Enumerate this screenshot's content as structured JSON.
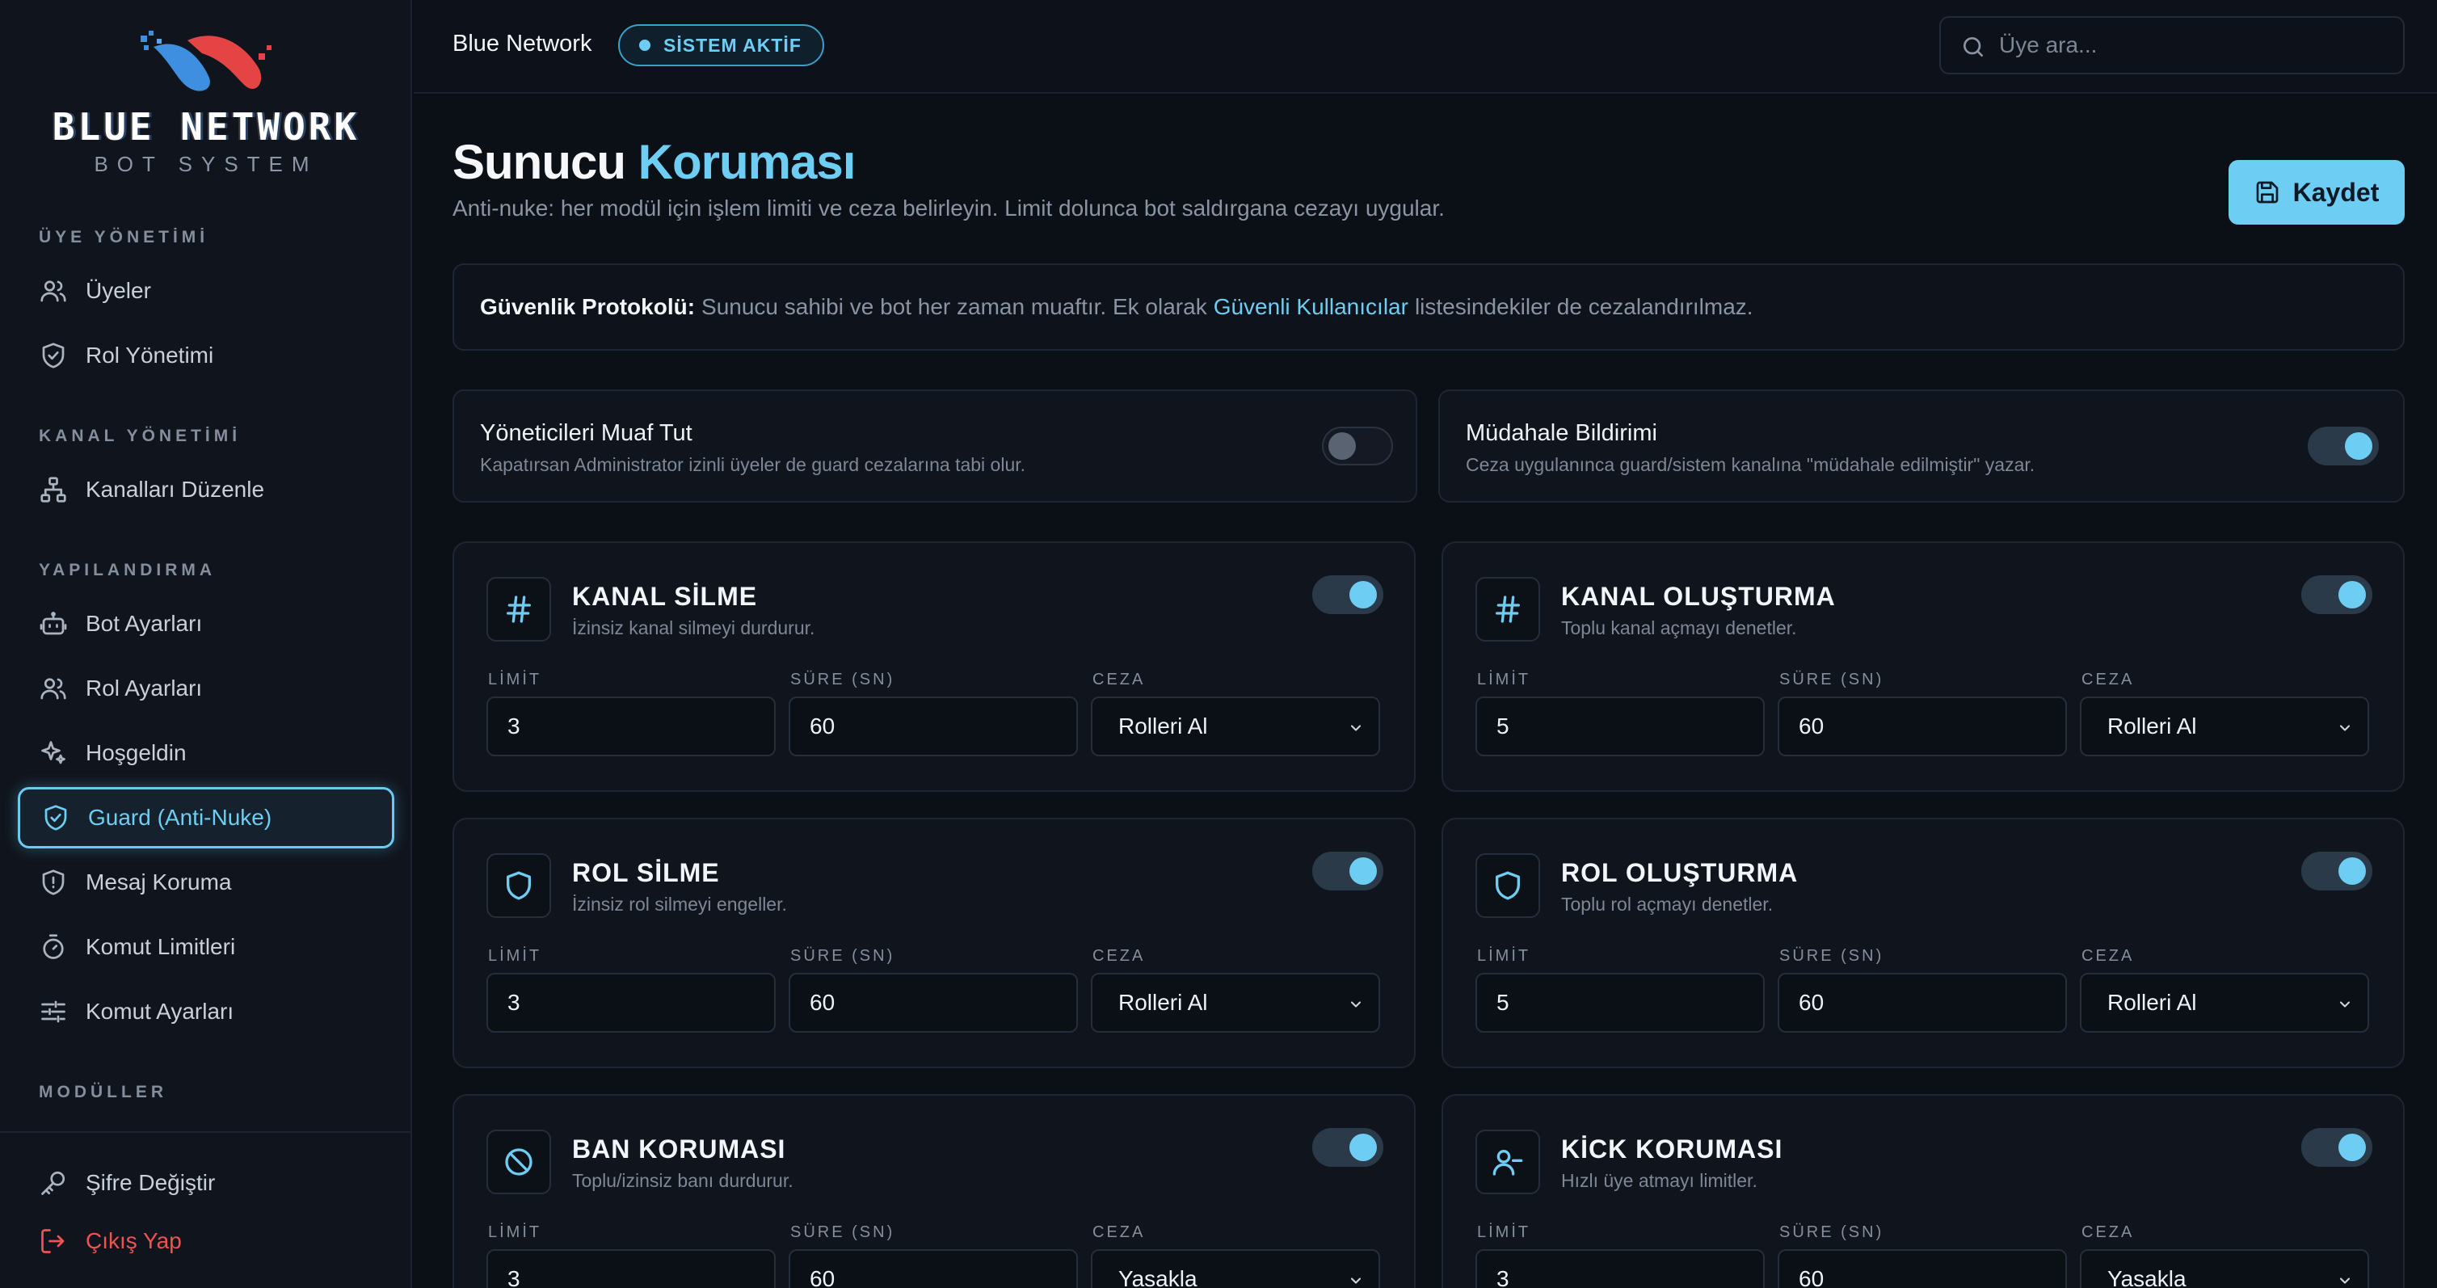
{
  "brand": {
    "logo_title": "BLUE NETWORK",
    "logo_sub": "BOT SYSTEM"
  },
  "sidebar": {
    "sections": [
      {
        "label": "ÜYE YÖNETİMİ"
      },
      {
        "label": "KANAL YÖNETİMİ"
      },
      {
        "label": "YAPILANDIRMA"
      },
      {
        "label": "MODÜLLER"
      }
    ],
    "items": [
      {
        "label": "Üyeler",
        "icon": "users-icon"
      },
      {
        "label": "Rol Yönetimi",
        "icon": "shield-check-icon"
      },
      {
        "label": "Kanalları Düzenle",
        "icon": "sitemap-icon"
      },
      {
        "label": "Bot Ayarları",
        "icon": "bot-icon"
      },
      {
        "label": "Rol Ayarları",
        "icon": "users-icon"
      },
      {
        "label": "Hoşgeldin",
        "icon": "sparkle-icon"
      },
      {
        "label": "Guard (Anti-Nuke)",
        "icon": "shield-check-icon",
        "active": true
      },
      {
        "label": "Mesaj Koruma",
        "icon": "shield-alert-icon"
      },
      {
        "label": "Komut Limitleri",
        "icon": "timer-icon"
      },
      {
        "label": "Komut Ayarları",
        "icon": "sliders-icon"
      }
    ],
    "footer": [
      {
        "label": "Şifre Değiştir",
        "icon": "key-icon"
      },
      {
        "label": "Çıkış Yap",
        "icon": "logout-icon"
      }
    ]
  },
  "header": {
    "brand": "Blue Network",
    "status": "SİSTEM AKTİF",
    "search_placeholder": "Üye ara..."
  },
  "page": {
    "title_a": "Sunucu",
    "title_b": "Koruması",
    "subtitle": "Anti-nuke: her modül için işlem limiti ve ceza belirleyin. Limit dolunca bot saldırgana cezayı uygular.",
    "save_label": "Kaydet"
  },
  "banner": {
    "bold": "Güvenlik Protokolü:",
    "text_a": "Sunucu sahibi ve bot her zaman muaftır. Ek olarak",
    "link": "Güvenli Kullanıcılar",
    "text_b": "listesindekiler de cezalandırılmaz."
  },
  "toggles": [
    {
      "title": "Yöneticileri Muaf Tut",
      "desc": "Kapatırsan Administrator izinli üyeler de guard cezalarına tabi olur.",
      "on": false
    },
    {
      "title": "Müdahale Bildirimi",
      "desc": "Ceza uygulanınca guard/sistem kanalına \"müdahale edilmiştir\" yazar.",
      "on": true
    }
  ],
  "field_labels": {
    "limit": "LİMİT",
    "duration": "SÜRE (SN)",
    "penalty": "CEZA"
  },
  "modules": [
    {
      "title": "KANAL SİLME",
      "desc": "İzinsiz kanal silmeyi durdurur.",
      "icon": "hash-icon",
      "limit": "3",
      "duration": "60",
      "penalty": "Rolleri Al",
      "on": true
    },
    {
      "title": "KANAL OLUŞTURMA",
      "desc": "Toplu kanal açmayı denetler.",
      "icon": "hash-icon",
      "limit": "5",
      "duration": "60",
      "penalty": "Rolleri Al",
      "on": true
    },
    {
      "title": "ROL SİLME",
      "desc": "İzinsiz rol silmeyi engeller.",
      "icon": "shield-icon",
      "limit": "3",
      "duration": "60",
      "penalty": "Rolleri Al",
      "on": true
    },
    {
      "title": "ROL OLUŞTURMA",
      "desc": "Toplu rol açmayı denetler.",
      "icon": "shield-icon",
      "limit": "5",
      "duration": "60",
      "penalty": "Rolleri Al",
      "on": true
    },
    {
      "title": "BAN KORUMASI",
      "desc": "Toplu/izinsiz banı durdurur.",
      "icon": "ban-icon",
      "limit": "3",
      "duration": "60",
      "penalty": "Yasakla",
      "on": true
    },
    {
      "title": "KİCK KORUMASI",
      "desc": "Hızlı üye atmayı limitler.",
      "icon": "user-minus-icon",
      "limit": "3",
      "duration": "60",
      "penalty": "Yasakla",
      "on": true
    }
  ],
  "colors": {
    "accent": "#6ecdf2",
    "danger": "#f05252",
    "background": "#0b0f16"
  }
}
